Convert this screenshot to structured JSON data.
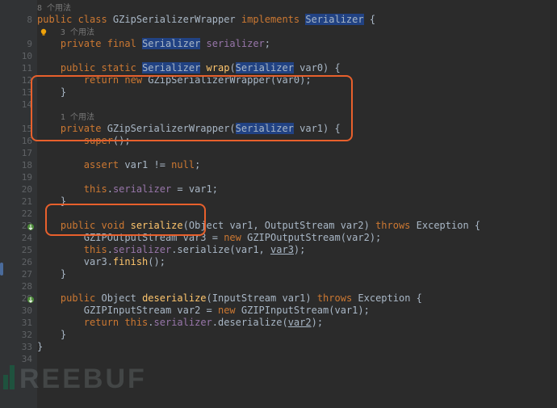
{
  "gutter": {
    "7": "",
    "8": "8",
    "9a": "",
    "9": "9",
    "10": "10",
    "11": "11",
    "12": "12",
    "13": "13",
    "14": "14",
    "14b": "",
    "15": "15",
    "16": "16",
    "17": "17",
    "18": "18",
    "19": "19",
    "20": "20",
    "21": "21",
    "22": "22",
    "23": "23",
    "24": "24",
    "25": "25",
    "26": "26",
    "27": "27",
    "28": "28",
    "29": "29",
    "30": "30",
    "31": "31",
    "32": "32",
    "33": "33",
    "34": "34"
  },
  "hints": {
    "usages8": "8 个用法",
    "usages3": "3 个用法",
    "usages1": "1 个用法"
  },
  "code": {
    "l8": {
      "kw1": "public class ",
      "cls": "GZipSerializerWrapper ",
      "kw2": "implements ",
      "iface": "Serializer",
      "tail": " {"
    },
    "l9": {
      "kw": "private final ",
      "type": "Serializer",
      "fld": " serializer",
      "tail": ";"
    },
    "l11": {
      "kw": "public static ",
      "ret": "Serializer",
      "fn": " wrap",
      "p1": "(",
      "ptype": "Serializer",
      "pname": " var0",
      "p2": ") {"
    },
    "l12": {
      "kw": "return new ",
      "cls": "GZipSerializerWrapper",
      "args": "(var0);"
    },
    "l13": {
      "brace": "}"
    },
    "l15": {
      "kw": "private ",
      "cls": "GZipSerializerWrapper",
      "p1": "(",
      "ptype": "Serializer",
      "pname": " var1",
      "p2": ") {"
    },
    "l16": {
      "kw": "super",
      "tail": "();"
    },
    "l18": {
      "kw": "assert ",
      "expr": "var1 != ",
      "nul": "null",
      "tail": ";"
    },
    "l20": {
      "thiss": "this",
      "dot": ".",
      "fld": "serializer",
      "rest": " = var1;"
    },
    "l21": {
      "brace": "}"
    },
    "l23": {
      "kw": "public void ",
      "fn": "serialize",
      "p": "(Object var1, OutputStream var2) ",
      "kw2": "throws ",
      "exc": "Exception ",
      "tail": "{"
    },
    "l24": {
      "type": "GZIPOutputStream ",
      "var": "var3 = ",
      "kw": "new ",
      "cls": "GZIPOutputStream",
      "args": "(var2);"
    },
    "l25": {
      "thiss": "this",
      "dot": ".",
      "fld": "serializer",
      "call": ".serialize(var1, ",
      "u": "var3",
      "tail": ");"
    },
    "l26": {
      "v": "var3.",
      "fn": "finish",
      "tail": "();"
    },
    "l27": {
      "brace": "}"
    },
    "l29": {
      "kw": "public ",
      "ret": "Object ",
      "fn": "deserialize",
      "p": "(InputStream var1) ",
      "kw2": "throws ",
      "exc": "Exception ",
      "tail": "{"
    },
    "l30": {
      "type": "GZIPInputStream ",
      "var": "var2 = ",
      "kw": "new ",
      "cls": "GZIPInputStream",
      "args": "(var1);"
    },
    "l31": {
      "kw": "return ",
      "thiss": "this",
      "dot": ".",
      "fld": "serializer",
      "call": ".deserialize(",
      "u": "var2",
      "tail": ");"
    },
    "l32": {
      "brace": "}"
    },
    "l33": {
      "brace": "}"
    }
  },
  "watermark": "REEBUF",
  "icons": {
    "override": "override-marker",
    "bulb": "intention-bulb"
  }
}
